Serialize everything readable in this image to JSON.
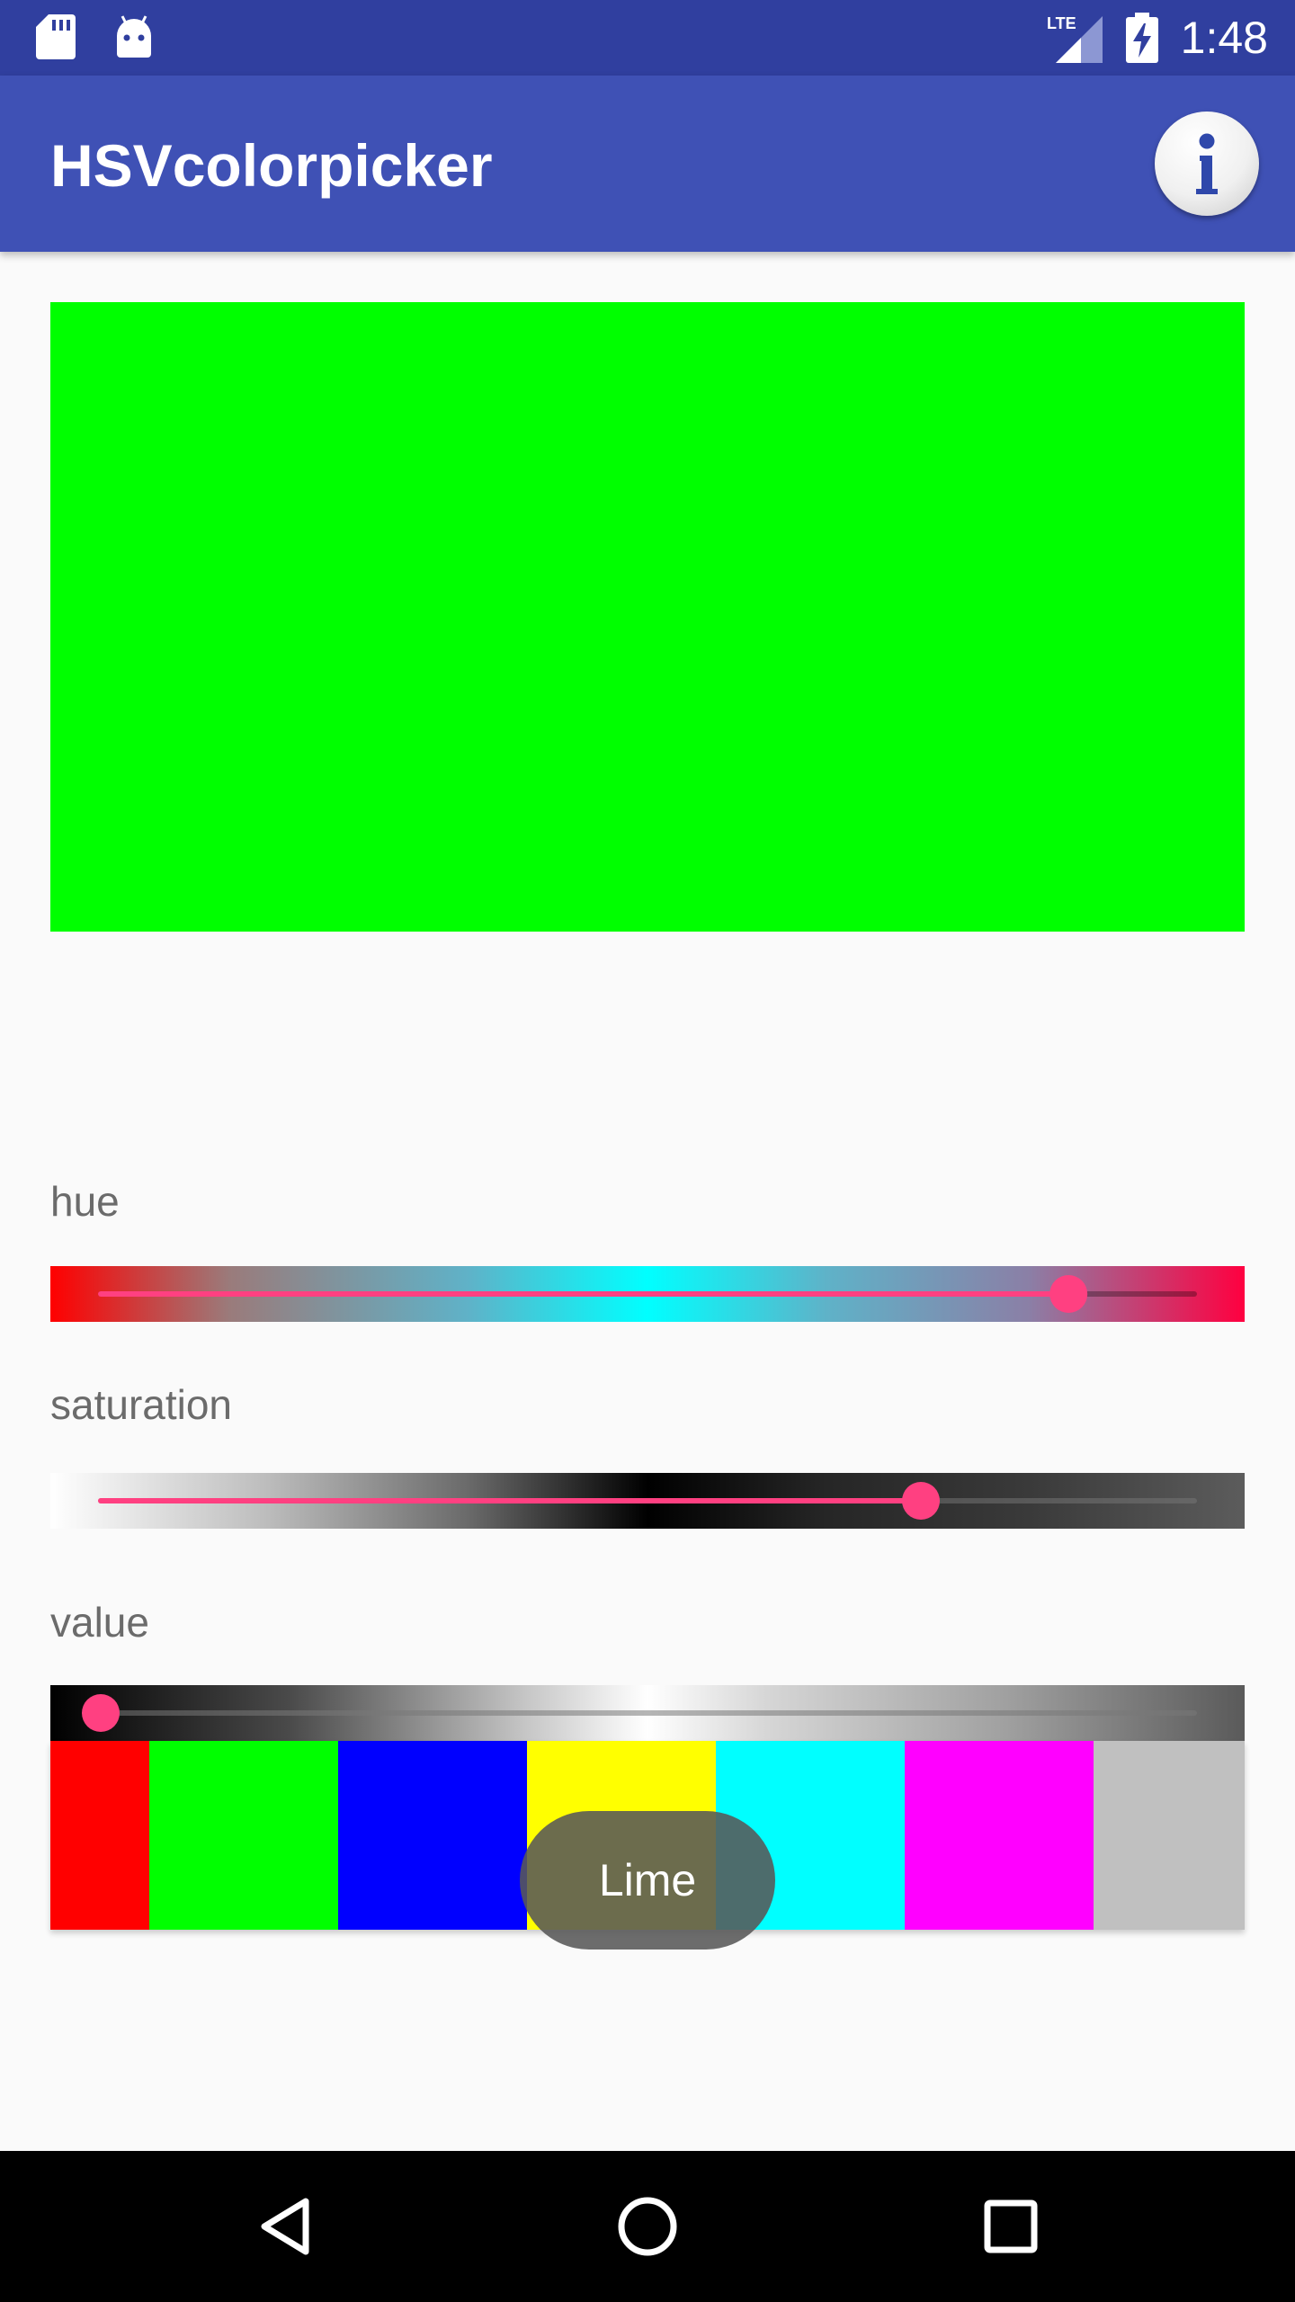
{
  "status_bar": {
    "time": "1:48",
    "network_label": "LTE",
    "icons": [
      "sd-card-icon",
      "android-icon",
      "lte-signal-icon",
      "battery-charging-icon"
    ]
  },
  "app_bar": {
    "title": "HSVcolorpicker",
    "info_icon": "info-icon",
    "colors": {
      "status": "#303f9f",
      "primary": "#3f51b5"
    }
  },
  "preview": {
    "color": "#00ff00"
  },
  "sliders": {
    "hue": {
      "label": "hue",
      "fraction": 0.885
    },
    "saturation": {
      "label": "saturation",
      "fraction": 0.75
    },
    "value": {
      "label": "value",
      "fraction": 0.0
    },
    "accent": "#ff4081"
  },
  "swatches": [
    {
      "color": "#ff0000"
    },
    {
      "color": "#00ff00"
    },
    {
      "color": "#0000ff"
    },
    {
      "color": "#ffff00"
    },
    {
      "color": "#00ffff"
    },
    {
      "color": "#ff00ff"
    },
    {
      "color": "#c0c0c0"
    }
  ],
  "toast": {
    "text": "Lime"
  },
  "nav_bar": {
    "icons": [
      "back-icon",
      "home-icon",
      "recents-icon"
    ]
  }
}
